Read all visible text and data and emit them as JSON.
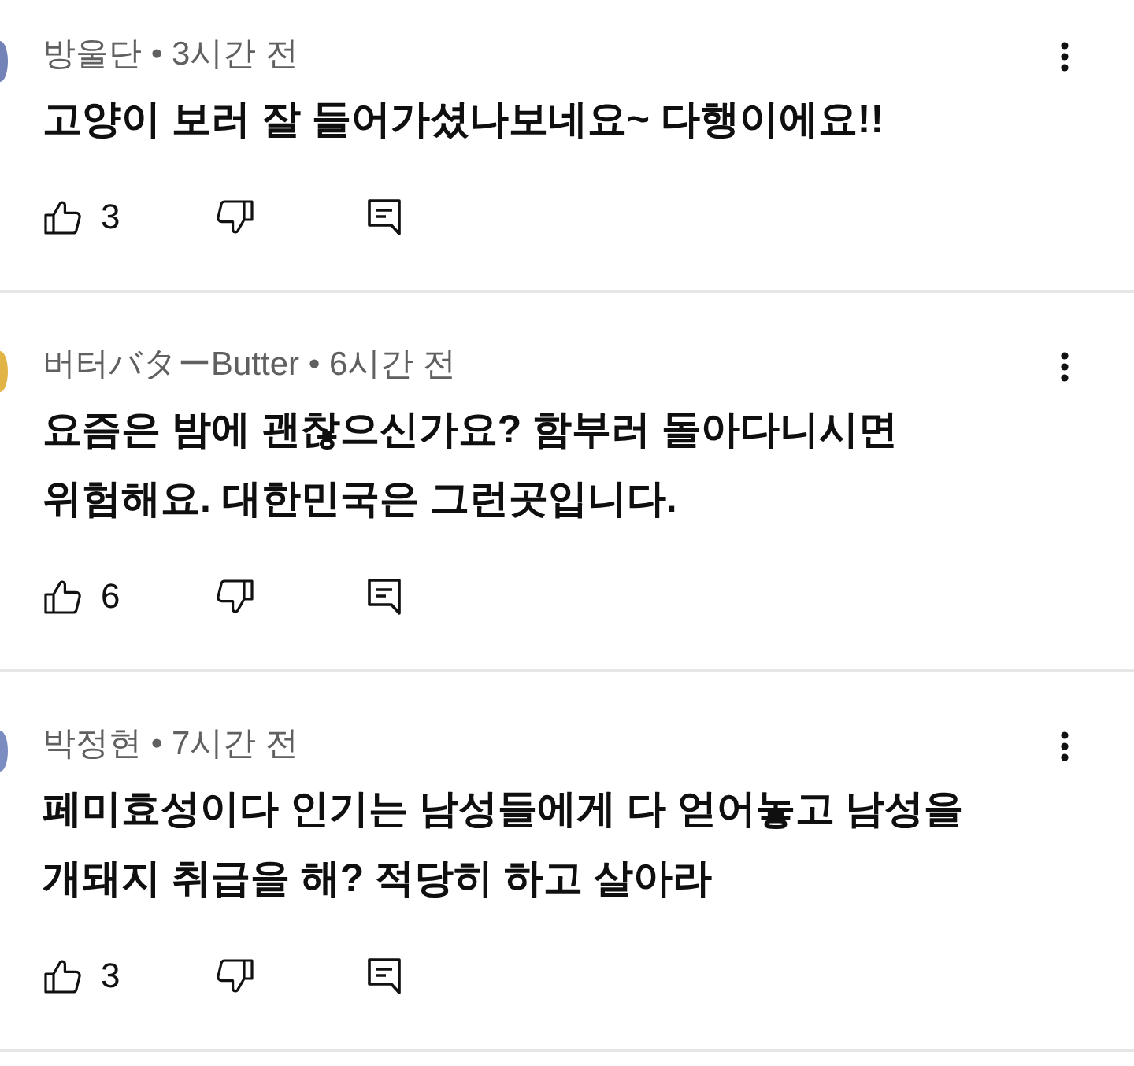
{
  "comments": [
    {
      "avatar": {
        "color": "#7383b8"
      },
      "byline": "방울단 • 3시간 전",
      "text": "고양이 보러 잘 들어가셨나보네요~ 다행이에요!!",
      "likes": "3"
    },
    {
      "avatar": {
        "color": "#e2b445"
      },
      "byline": "버터バターButter • 6시간 전",
      "text": "요즘은 밤에 괜찮으신가요? 함부러 돌아다니시면\n위험해요. 대한민국은 그런곳입니다.",
      "likes": "6"
    },
    {
      "avatar": {
        "color": "#7b8cc0"
      },
      "byline": "박정현 • 7시간 전",
      "text": "페미효성이다 인기는 남성들에게 다 얻어놓고 남성을\n개돼지 취급을 해? 적당히 하고 살아라",
      "likes": "3"
    }
  ]
}
